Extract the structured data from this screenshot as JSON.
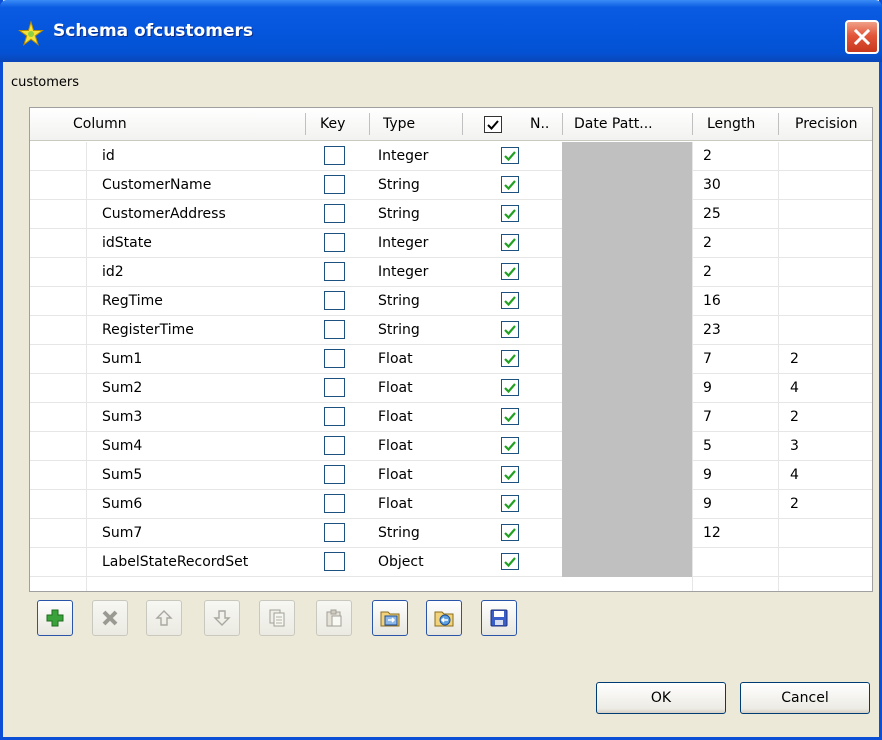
{
  "window": {
    "title": "Schema ofcustomers"
  },
  "schema_name": "customers",
  "columns": {
    "column": "Column",
    "key": "Key",
    "type": "Type",
    "nullable": "N..",
    "date_pattern": "Date Patt...",
    "length": "Length",
    "precision": "Precision"
  },
  "rows": [
    {
      "column": "id",
      "key": false,
      "type": "Integer",
      "nullable": true,
      "date_pattern": "",
      "length": "2",
      "precision": ""
    },
    {
      "column": "CustomerName",
      "key": false,
      "type": "String",
      "nullable": true,
      "date_pattern": "",
      "length": "30",
      "precision": ""
    },
    {
      "column": "CustomerAddress",
      "key": false,
      "type": "String",
      "nullable": true,
      "date_pattern": "",
      "length": "25",
      "precision": ""
    },
    {
      "column": "idState",
      "key": false,
      "type": "Integer",
      "nullable": true,
      "date_pattern": "",
      "length": "2",
      "precision": ""
    },
    {
      "column": "id2",
      "key": false,
      "type": "Integer",
      "nullable": true,
      "date_pattern": "",
      "length": "2",
      "precision": ""
    },
    {
      "column": "RegTime",
      "key": false,
      "type": "String",
      "nullable": true,
      "date_pattern": "",
      "length": "16",
      "precision": ""
    },
    {
      "column": "RegisterTime",
      "key": false,
      "type": "String",
      "nullable": true,
      "date_pattern": "",
      "length": "23",
      "precision": ""
    },
    {
      "column": "Sum1",
      "key": false,
      "type": "Float",
      "nullable": true,
      "date_pattern": "",
      "length": "7",
      "precision": "2"
    },
    {
      "column": "Sum2",
      "key": false,
      "type": "Float",
      "nullable": true,
      "date_pattern": "",
      "length": "9",
      "precision": "4"
    },
    {
      "column": "Sum3",
      "key": false,
      "type": "Float",
      "nullable": true,
      "date_pattern": "",
      "length": "7",
      "precision": "2"
    },
    {
      "column": "Sum4",
      "key": false,
      "type": "Float",
      "nullable": true,
      "date_pattern": "",
      "length": "5",
      "precision": "3"
    },
    {
      "column": "Sum5",
      "key": false,
      "type": "Float",
      "nullable": true,
      "date_pattern": "",
      "length": "9",
      "precision": "4"
    },
    {
      "column": "Sum6",
      "key": false,
      "type": "Float",
      "nullable": true,
      "date_pattern": "",
      "length": "9",
      "precision": "2"
    },
    {
      "column": "Sum7",
      "key": false,
      "type": "String",
      "nullable": true,
      "date_pattern": "",
      "length": "12",
      "precision": ""
    },
    {
      "column": "LabelStateRecordSet",
      "key": false,
      "type": "Object",
      "nullable": true,
      "date_pattern": "",
      "length": "",
      "precision": ""
    }
  ],
  "toolbar": [
    {
      "name": "add-row-button",
      "icon": "plus-icon",
      "enabled": true
    },
    {
      "name": "remove-row-button",
      "icon": "delete-x-icon",
      "enabled": false
    },
    {
      "name": "move-up-button",
      "icon": "arrow-up-icon",
      "enabled": false
    },
    {
      "name": "move-down-button",
      "icon": "arrow-down-icon",
      "enabled": false
    },
    {
      "name": "copy-button",
      "icon": "copy-icon",
      "enabled": false
    },
    {
      "name": "paste-button",
      "icon": "paste-icon",
      "enabled": false
    },
    {
      "name": "import-schema-button",
      "icon": "import-icon",
      "enabled": true
    },
    {
      "name": "export-schema-button",
      "icon": "export-icon",
      "enabled": true
    },
    {
      "name": "save-schema-button",
      "icon": "save-icon",
      "enabled": true
    }
  ],
  "buttons": {
    "ok": "OK",
    "cancel": "Cancel"
  },
  "colors": {
    "titlebar": "#0556dd",
    "checkmark": "#21a121",
    "date_pattern_cell": "#c0c0c0"
  }
}
